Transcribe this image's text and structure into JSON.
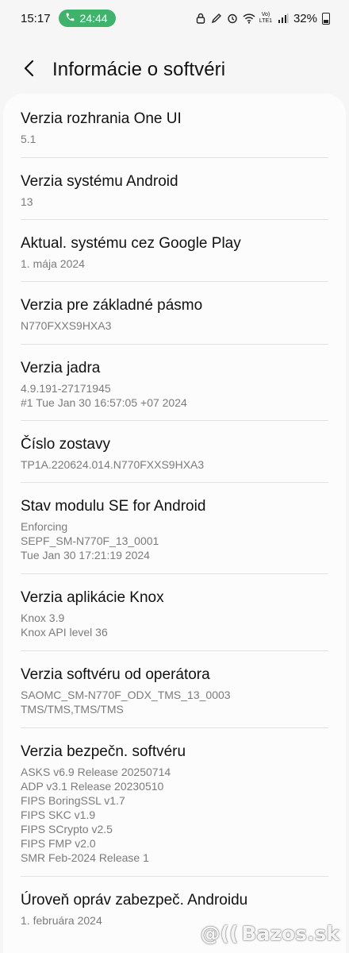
{
  "status_bar": {
    "time": "15:17",
    "call_timer": "24:44",
    "network_label": "Vo) LTE1",
    "battery": "32%"
  },
  "header": {
    "title": "Informácie o softvéri"
  },
  "items": [
    {
      "title": "Verzia rozhrania One UI",
      "sub": "5.1"
    },
    {
      "title": "Verzia systému Android",
      "sub": "13"
    },
    {
      "title": "Aktual. systému cez Google Play",
      "sub": "1. mája 2024"
    },
    {
      "title": "Verzia pre základné pásmo",
      "sub": "N770FXXS9HXA3"
    },
    {
      "title": "Verzia jadra",
      "sub": "4.9.191-27171945\n#1 Tue Jan 30 16:57:05 +07 2024"
    },
    {
      "title": "Číslo zostavy",
      "sub": "TP1A.220624.014.N770FXXS9HXA3"
    },
    {
      "title": "Stav modulu SE for Android",
      "sub": "Enforcing\nSEPF_SM-N770F_13_0001\nTue Jan 30 17:21:19 2024"
    },
    {
      "title": "Verzia aplikácie Knox",
      "sub": "Knox 3.9\nKnox API level 36"
    },
    {
      "title": "Verzia softvéru od operátora",
      "sub": "SAOMC_SM-N770F_ODX_TMS_13_0003\nTMS/TMS,TMS/TMS"
    },
    {
      "title": "Verzia bezpečn. softvéru",
      "sub": "ASKS v6.9 Release 20250714\nADP v3.1 Release 20230510\nFIPS BoringSSL v1.7\nFIPS SKC v1.9\nFIPS SCrypto v2.5\nFIPS FMP v2.0\nSMR Feb-2024 Release 1"
    },
    {
      "title": "Úroveň opráv zabezpeč. Androidu",
      "sub": "1. februára 2024"
    }
  ],
  "watermark": "Bazos.sk"
}
